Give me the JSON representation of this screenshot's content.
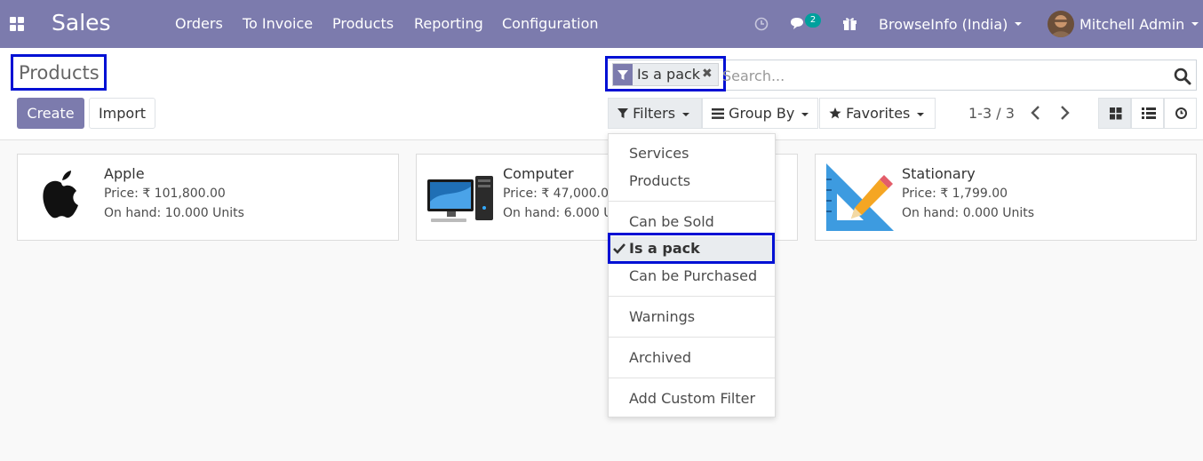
{
  "navbar": {
    "app_name": "Sales",
    "menu": [
      "Orders",
      "To Invoice",
      "Products",
      "Reporting",
      "Configuration"
    ],
    "message_count": "2",
    "company": "BrowseInfo (India)",
    "user": "Mitchell Admin"
  },
  "control": {
    "title": "Products",
    "create_label": "Create",
    "import_label": "Import",
    "facet_label": "Is a pack",
    "search_placeholder": "Search...",
    "filters_label": "Filters",
    "groupby_label": "Group By",
    "favorites_label": "Favorites",
    "pager": "1-3 / 3"
  },
  "products": [
    {
      "name": "Apple",
      "price": "Price: ₹ 101,800.00",
      "onhand": "On hand: 10.000 Units"
    },
    {
      "name": "Computer",
      "price": "Price: ₹ 47,000.00",
      "onhand": "On hand: 6.000 Units"
    },
    {
      "name": "Stationary",
      "price": "Price: ₹ 1,799.00",
      "onhand": "On hand: 0.000 Units"
    }
  ],
  "filters_menu": {
    "items": [
      "Services",
      "Products",
      "Can be Sold",
      "Is a pack",
      "Can be Purchased",
      "Warnings",
      "Archived",
      "Add Custom Filter"
    ],
    "selected": "Is a pack"
  },
  "colors": {
    "brand": "#7c7bad",
    "highlight_border": "#0010d4",
    "badge": "#00a09d"
  },
  "icons": [
    "apps-icon",
    "clock-icon",
    "chat-icon",
    "gift-icon",
    "search-icon",
    "filter-icon",
    "list-icon",
    "star-icon",
    "chevron-left-icon",
    "chevron-right-icon",
    "kanban-icon",
    "activity-icon",
    "check-icon",
    "close-icon"
  ]
}
